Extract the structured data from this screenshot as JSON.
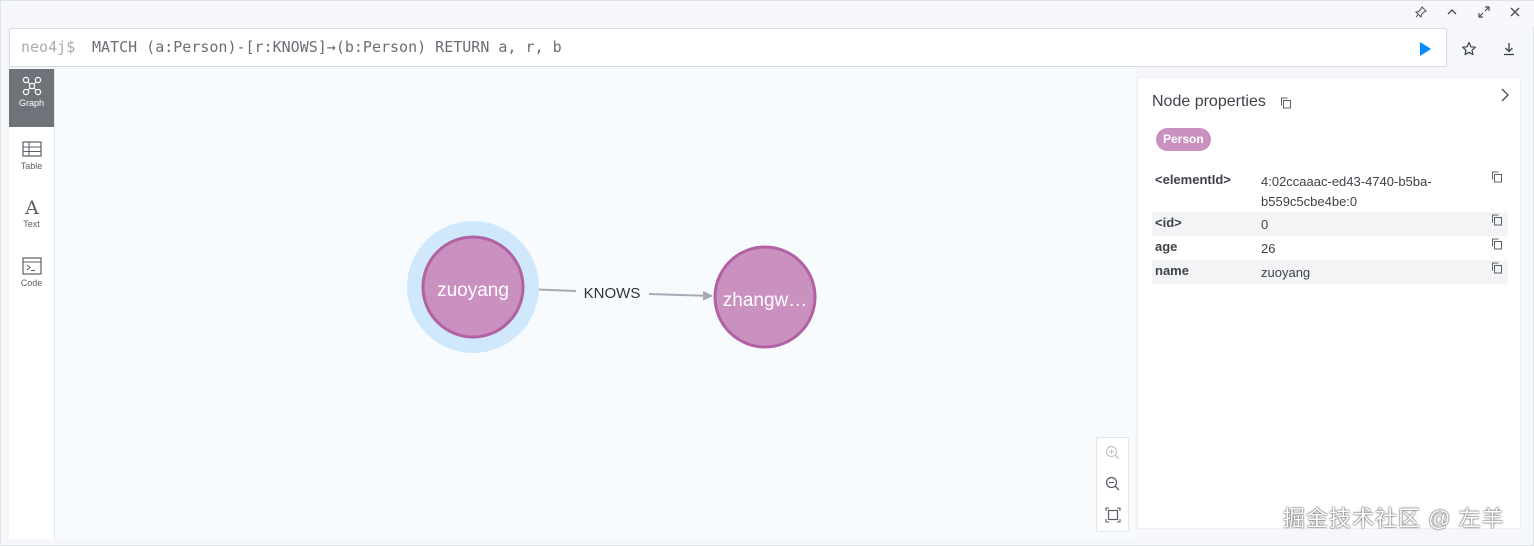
{
  "frame_controls": [
    "pin-icon",
    "collapse-up-icon",
    "expand-icon",
    "close-icon"
  ],
  "editor": {
    "prompt": "neo4j$",
    "query": "MATCH (a:Person)-[r:KNOWS]→(b:Person) RETURN a, r, b"
  },
  "sidebar": {
    "items": [
      {
        "label": "Graph",
        "icon": "graph-icon",
        "active": true
      },
      {
        "label": "Table",
        "icon": "table-icon",
        "active": false
      },
      {
        "label": "Text",
        "icon": "text-icon",
        "active": false
      },
      {
        "label": "Code",
        "icon": "code-icon",
        "active": false
      }
    ]
  },
  "graph": {
    "nodes": [
      {
        "caption": "zuoyang",
        "selected": true
      },
      {
        "caption": "zhangw…",
        "selected": false
      }
    ],
    "relationship": {
      "type": "KNOWS"
    },
    "colors": {
      "node_fill": "#c990c0",
      "node_stroke": "#b261a5",
      "selection_halo": "#cfe8fb",
      "edge": "#a5abb6"
    }
  },
  "props_panel": {
    "title": "Node properties",
    "label": "Person",
    "rows": [
      {
        "key": "<elementId>",
        "value": "4:02ccaaac-ed43-4740-b5ba-b559c5cbe4be:0"
      },
      {
        "key": "<id>",
        "value": "0"
      },
      {
        "key": "age",
        "value": "26"
      },
      {
        "key": "name",
        "value": "zuoyang"
      }
    ]
  },
  "watermark": "掘金技术社区 @ 左羊"
}
